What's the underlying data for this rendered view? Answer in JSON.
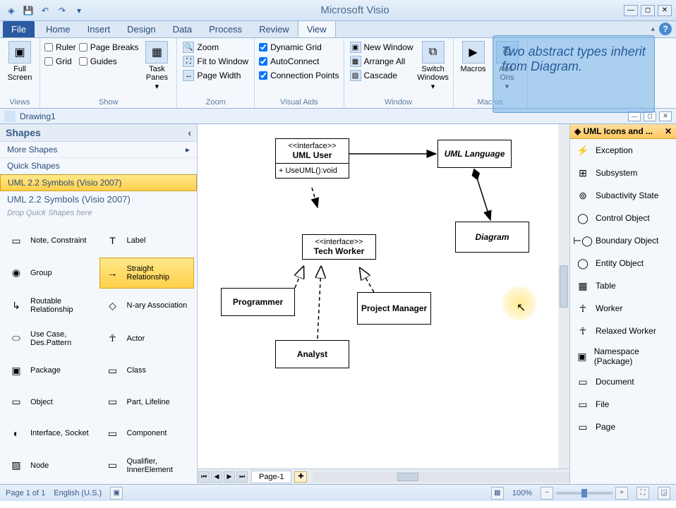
{
  "app_title": "Microsoft Visio",
  "tabs": [
    "File",
    "Home",
    "Insert",
    "Design",
    "Data",
    "Process",
    "Review",
    "View"
  ],
  "active_tab": "View",
  "ribbon": {
    "views": {
      "label": "Views",
      "full_screen": "Full Screen"
    },
    "show": {
      "label": "Show",
      "ruler": "Ruler",
      "grid": "Grid",
      "page_breaks": "Page Breaks",
      "guides": "Guides",
      "task_panes": "Task Panes"
    },
    "zoom": {
      "label": "Zoom",
      "zoom": "Zoom",
      "fit": "Fit to Window",
      "page_width": "Page Width"
    },
    "visual_aids": {
      "label": "Visual Aids",
      "dynamic_grid": "Dynamic Grid",
      "autoconnect": "AutoConnect",
      "connection_points": "Connection Points"
    },
    "window": {
      "label": "Window",
      "new_window": "New Window",
      "arrange_all": "Arrange All",
      "cascade": "Cascade",
      "switch": "Switch Windows"
    },
    "macros": {
      "label": "Macros",
      "macros": "Macros",
      "addons": "Add-Ons"
    }
  },
  "tooltip_text": "Two abstract types inherit from Diagram.",
  "doc_title": "Drawing1",
  "shapes": {
    "header": "Shapes",
    "more": "More Shapes",
    "quick": "Quick Shapes",
    "stencil_sel": "UML 2.2 Symbols (Visio 2007)",
    "stencil_title": "UML 2.2 Symbols (Visio 2007)",
    "drop_hint": "Drop Quick Shapes here",
    "items": [
      {
        "name": "Note, Constraint",
        "icon": "▭"
      },
      {
        "name": "Label",
        "icon": "T"
      },
      {
        "name": "Group",
        "icon": "◉"
      },
      {
        "name": "Straight Relationship",
        "icon": "→",
        "sel": true
      },
      {
        "name": "Routable Relationship",
        "icon": "↳"
      },
      {
        "name": "N-ary Association",
        "icon": "◇"
      },
      {
        "name": "Use Case, Des.Pattern",
        "icon": "⬭"
      },
      {
        "name": "Actor",
        "icon": "☥"
      },
      {
        "name": "Package",
        "icon": "▣"
      },
      {
        "name": "Class",
        "icon": "▭"
      },
      {
        "name": "Object",
        "icon": "▭"
      },
      {
        "name": "Part, Lifeline",
        "icon": "▭"
      },
      {
        "name": "Interface, Socket",
        "icon": "◐"
      },
      {
        "name": "Component",
        "icon": "▭"
      },
      {
        "name": "Node",
        "icon": "▨"
      },
      {
        "name": "Qualifier, InnerElement",
        "icon": "▭"
      }
    ]
  },
  "diagram": {
    "uml_user": {
      "stereo": "<<interface>>",
      "name": "UML User",
      "op": "+ UseUML():void"
    },
    "uml_lang": {
      "name": "UML Language"
    },
    "diagram_box": {
      "name": "Diagram"
    },
    "tech_worker": {
      "stereo": "<<interface>>",
      "name": "Tech Worker"
    },
    "programmer": {
      "name": "Programmer"
    },
    "project_mgr": {
      "name": "Project Manager"
    },
    "analyst": {
      "name": "Analyst"
    }
  },
  "icons_panel": {
    "header": "UML Icons and ...",
    "items": [
      {
        "name": "Exception",
        "glyph": "⚡"
      },
      {
        "name": "Subsystem",
        "glyph": "⊞"
      },
      {
        "name": "Subactivity State",
        "glyph": "⊚"
      },
      {
        "name": "Control Object",
        "glyph": "◯"
      },
      {
        "name": "Boundary Object",
        "glyph": "⊢◯"
      },
      {
        "name": "Entity Object",
        "glyph": "◯"
      },
      {
        "name": "Table",
        "glyph": "▦"
      },
      {
        "name": "Worker",
        "glyph": "☥"
      },
      {
        "name": "Relaxed Worker",
        "glyph": "☥"
      },
      {
        "name": "Namespace (Package)",
        "glyph": "▣"
      },
      {
        "name": "Document",
        "glyph": "▭"
      },
      {
        "name": "File",
        "glyph": "▭"
      },
      {
        "name": "Page",
        "glyph": "▭"
      }
    ]
  },
  "page_tab": "Page-1",
  "status": {
    "page": "Page 1 of 1",
    "lang": "English (U.S.)",
    "zoom": "100%"
  }
}
